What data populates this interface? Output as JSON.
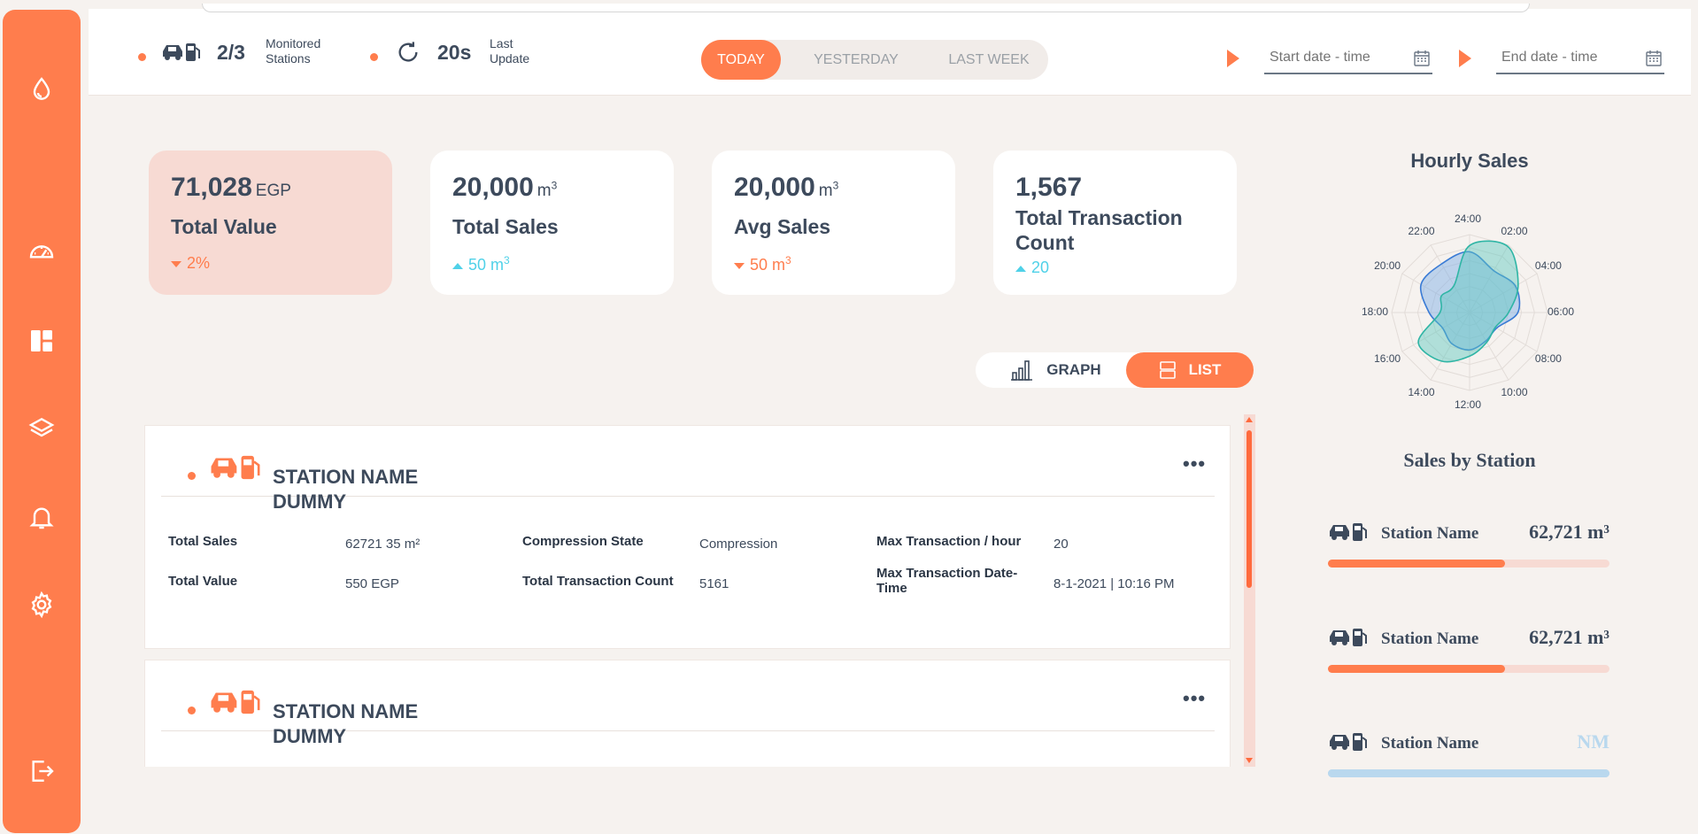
{
  "colors": {
    "accent": "#ff7d4d",
    "accent_light": "#f7dad3",
    "up": "#4fd1e8",
    "neutral_bar": "#b9d8ee"
  },
  "header": {
    "monitored_value": "2/3",
    "monitored_label": "Monitored Stations",
    "update_value": "20s",
    "update_label": "Last Update",
    "tabs": [
      "TODAY",
      "YESTERDAY",
      "LAST WEEK"
    ],
    "active_tab": "TODAY",
    "start_placeholder": "Start date - time",
    "end_placeholder": "End date - time"
  },
  "sidebar": {
    "items": [
      {
        "icon": "drop-icon"
      },
      {
        "icon": "gauge-icon"
      },
      {
        "icon": "dashboard-icon"
      },
      {
        "icon": "layers-icon"
      },
      {
        "icon": "bell-icon"
      },
      {
        "icon": "gear-icon"
      },
      {
        "icon": "logout-icon"
      }
    ]
  },
  "cards": [
    {
      "value": "71,028",
      "unit": "EGP",
      "unit_sup": "",
      "label": "Total Value",
      "delta": "2%",
      "delta_unit": "",
      "delta_sup": "",
      "trend": "down"
    },
    {
      "value": "20,000",
      "unit": "m",
      "unit_sup": "3",
      "label": "Total Sales",
      "delta": "50",
      "delta_unit": " m",
      "delta_sup": "3",
      "trend": "up"
    },
    {
      "value": "20,000",
      "unit": "m",
      "unit_sup": "3",
      "label": "Avg Sales",
      "delta": "50",
      "delta_unit": " m",
      "delta_sup": "3",
      "trend": "down"
    },
    {
      "value": "1,567",
      "unit": "",
      "unit_sup": "",
      "label": "Total Transaction Count",
      "delta": "20",
      "delta_unit": "",
      "delta_sup": "",
      "trend": "up"
    }
  ],
  "view_toggle": {
    "graph_label": "GRAPH",
    "list_label": "LIST",
    "active": "LIST"
  },
  "stations": [
    {
      "title": "STATION NAME DUMMY",
      "fields": [
        {
          "label": "Total Sales",
          "value": "62721 35 m²"
        },
        {
          "label": "Total Value",
          "value": "550 EGP"
        },
        {
          "label": "Compression State",
          "value": "Compression"
        },
        {
          "label": "Total Transaction Count",
          "value": "5161"
        },
        {
          "label": "Max Transaction / hour",
          "value": "20"
        },
        {
          "label": "Max Transaction Date-Time",
          "value": "8-1-2021 | 10:16 PM"
        }
      ]
    },
    {
      "title": "STATION NAME DUMMY",
      "fields": []
    }
  ],
  "hourly_sales": {
    "title": "Hourly Sales",
    "hours": [
      "24:00",
      "02:00",
      "04:00",
      "06:00",
      "08:00",
      "10:00",
      "12:00",
      "14:00",
      "16:00",
      "18:00",
      "20:00",
      "22:00"
    ]
  },
  "chart_data": {
    "type": "radar",
    "title": "Hourly Sales",
    "categories": [
      "24:00",
      "02:00",
      "04:00",
      "06:00",
      "08:00",
      "10:00",
      "12:00",
      "14:00",
      "16:00",
      "18:00",
      "20:00",
      "22:00"
    ],
    "series": [
      {
        "values": [
          0.78,
          0.62,
          0.68,
          0.62,
          0.4,
          0.42,
          0.48,
          0.46,
          0.4,
          0.52,
          0.72,
          0.72
        ]
      },
      {
        "values": [
          0.86,
          0.98,
          0.72,
          0.5,
          0.38,
          0.44,
          0.56,
          0.72,
          0.76,
          0.38,
          0.42,
          0.4
        ]
      }
    ]
  },
  "sales_by_station": {
    "title": "Sales by Station",
    "rows": [
      {
        "name": "Station Name",
        "value": "62,721 m³",
        "fill": 0.63,
        "status": "accent"
      },
      {
        "name": "Station Name",
        "value": "62,721 m³",
        "fill": 0.63,
        "status": "accent"
      },
      {
        "name": "Station Name",
        "value": "NM",
        "fill": 1.0,
        "status": "neutral"
      }
    ]
  }
}
